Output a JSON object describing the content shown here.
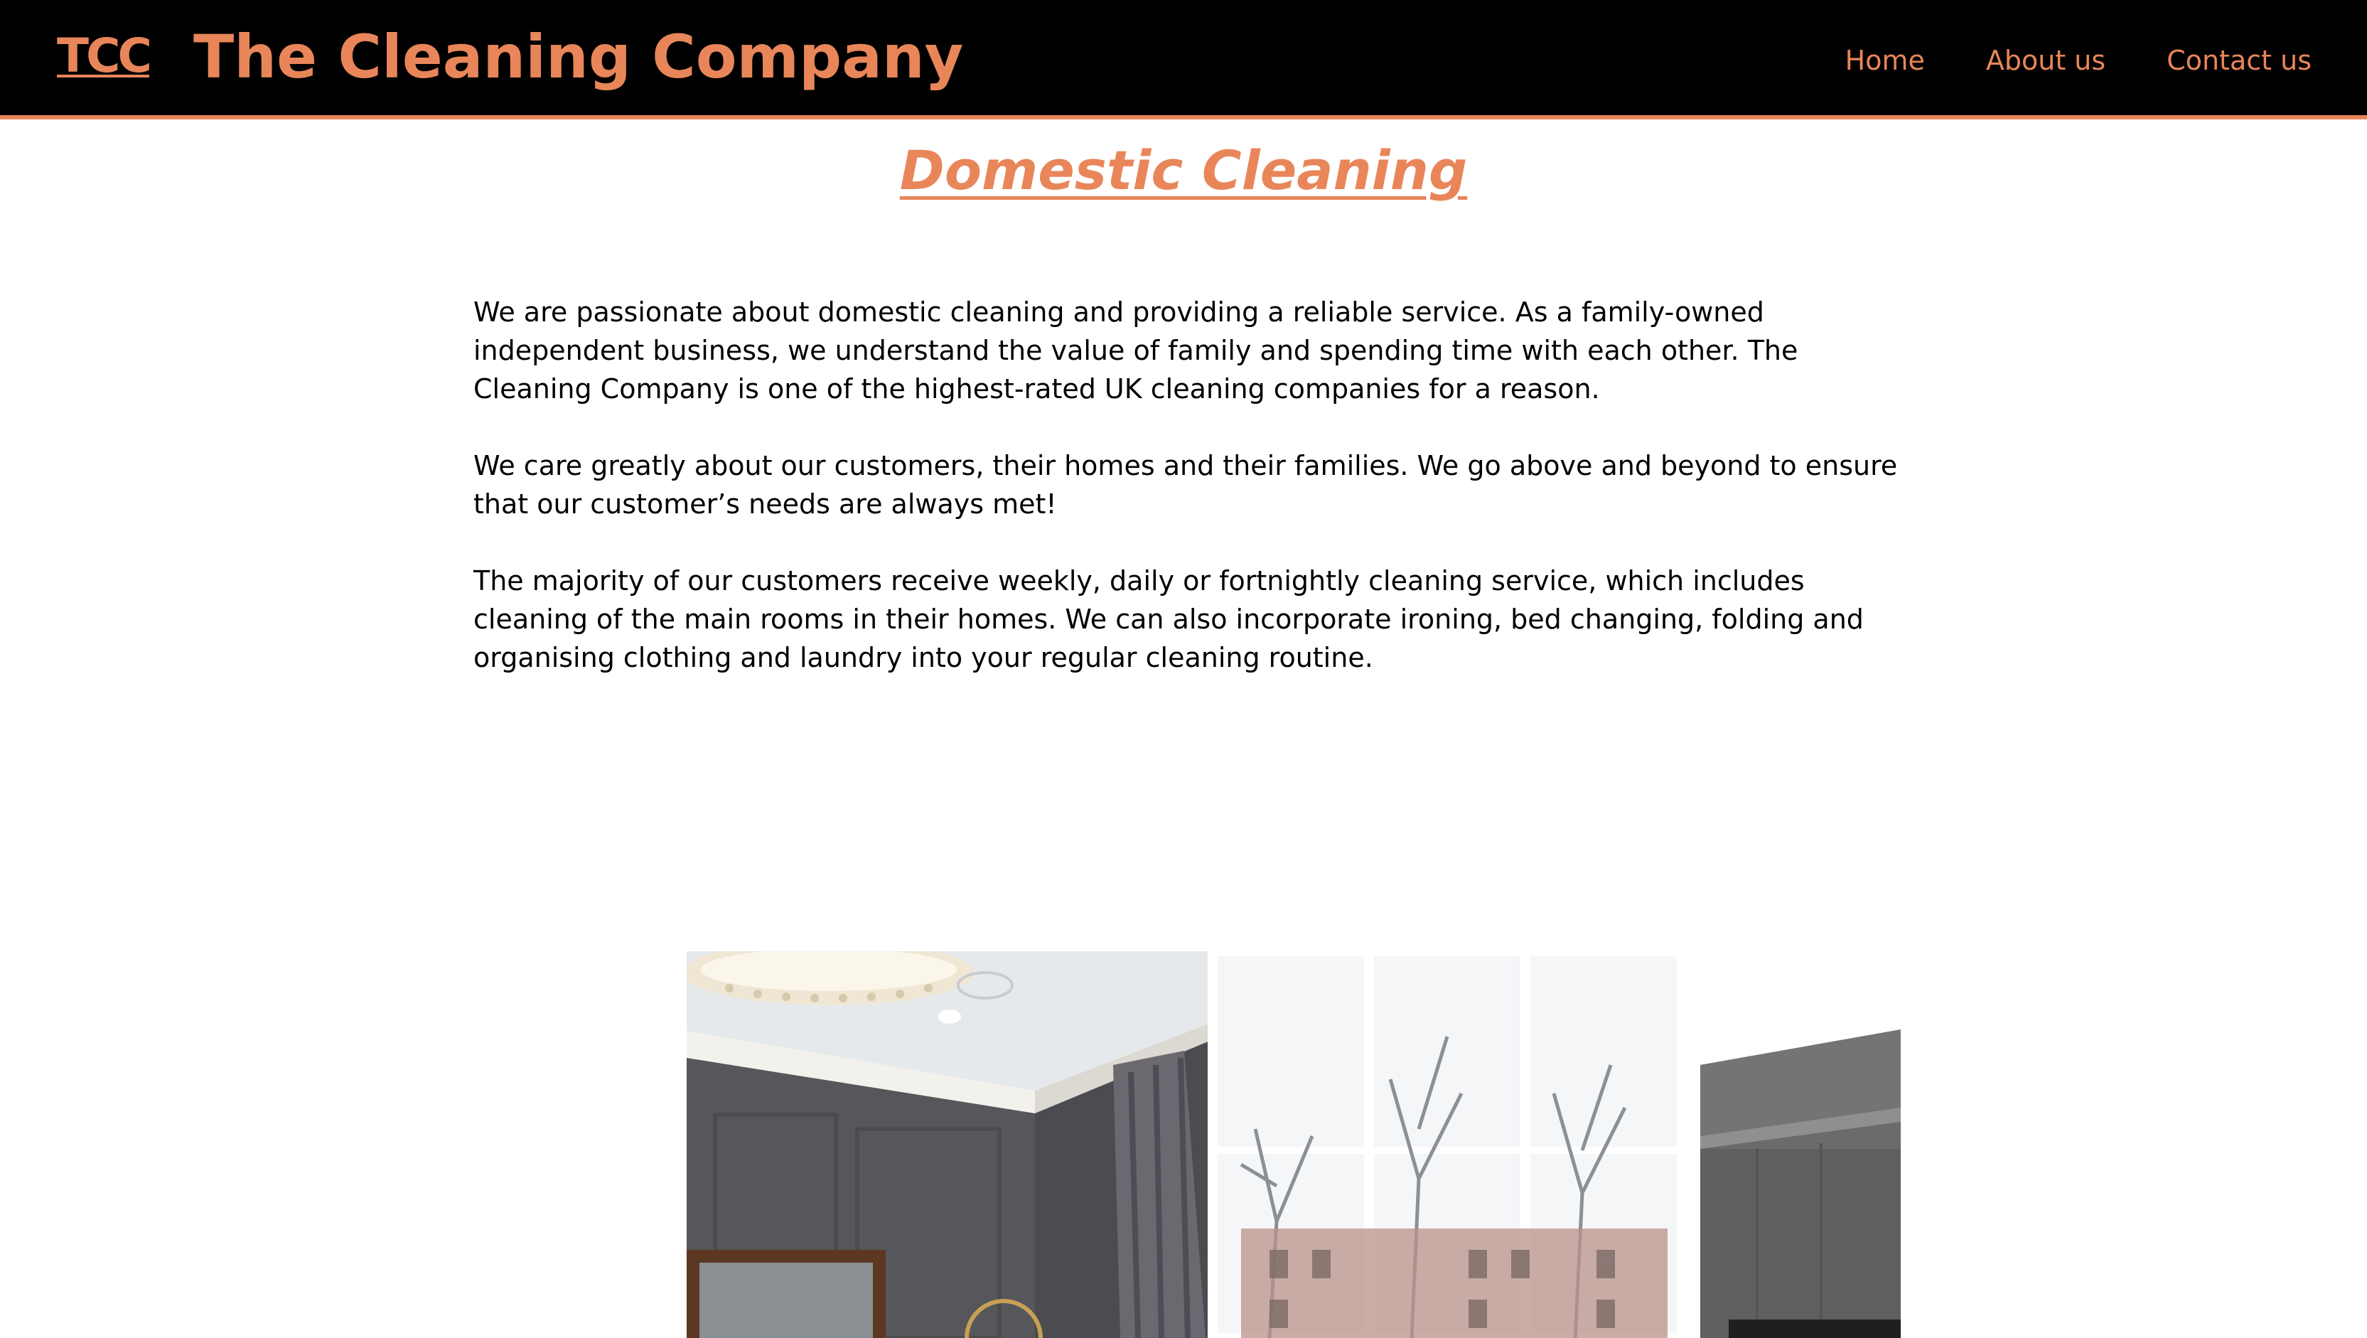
{
  "header": {
    "logo_text": "TCC",
    "site_title": "The Cleaning Company",
    "nav": [
      {
        "label": "Home"
      },
      {
        "label": "About us"
      },
      {
        "label": "Contact us"
      }
    ]
  },
  "main": {
    "heading": "Domestic Cleaning",
    "paragraphs": [
      "We are passionate about domestic cleaning and providing a reliable service. As a family-owned independent business, we understand the value of family and spending time with each other. The Cleaning Company is one of the highest-rated UK cleaning companies for a reason.",
      "We care greatly about our customers, their homes and their families. We go above and beyond to ensure that our customer’s needs are always met!",
      "The majority of our customers receive weekly, daily or fortnightly cleaning service, which includes cleaning of the main rooms in their homes. We can also incorporate ironing, bed changing, folding and organising clothing and laundry into your regular cleaning routine."
    ]
  },
  "colors": {
    "accent": "#e8865a",
    "header_bg": "#000000",
    "body_text": "#000000",
    "background": "#ffffff"
  }
}
